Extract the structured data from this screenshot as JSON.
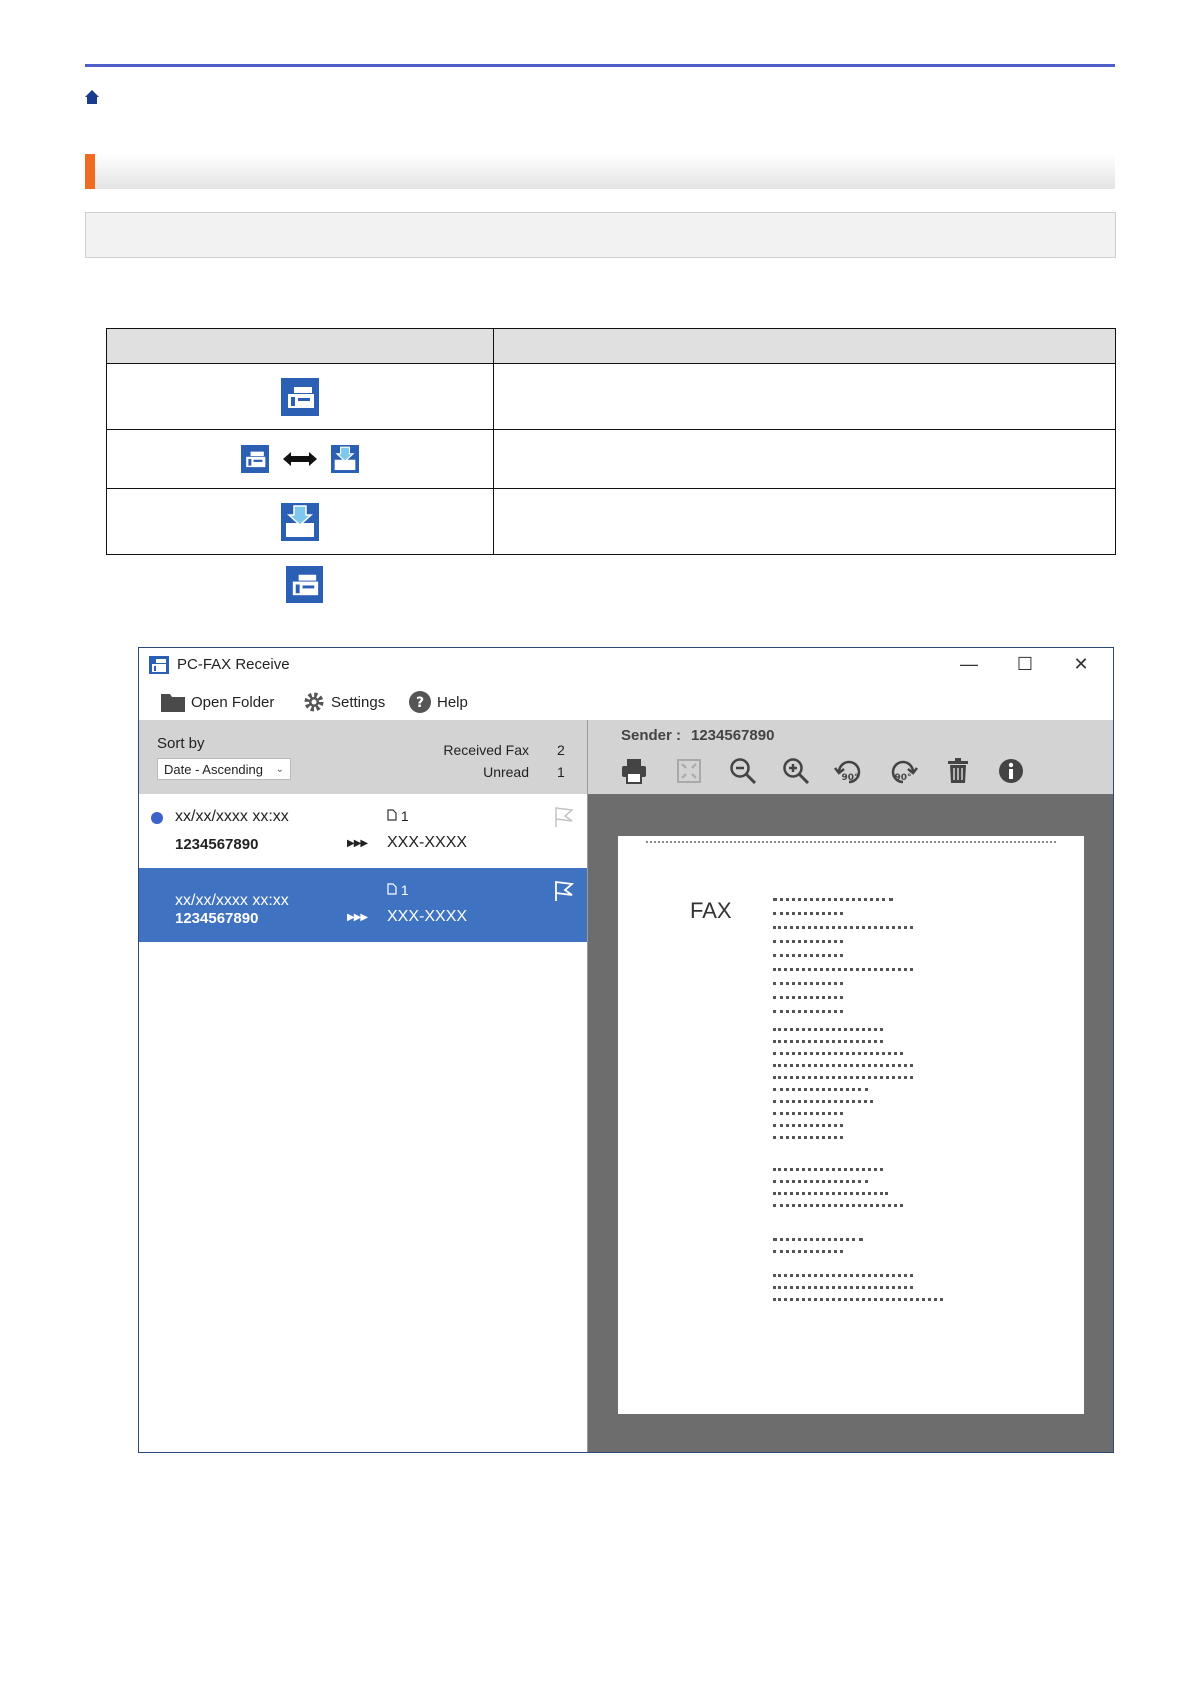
{
  "window": {
    "title": "PC-FAX Receive",
    "controls": {
      "minimize": "—",
      "maximize": "☐",
      "close": "✕"
    }
  },
  "toolbar": {
    "open_folder": "Open Folder",
    "settings": "Settings",
    "help": "Help"
  },
  "list_header": {
    "sort_label": "Sort by",
    "sort_value": "Date - Ascending",
    "received_label": "Received Fax",
    "received_count": "2",
    "unread_label": "Unread",
    "unread_count": "1"
  },
  "faxes": [
    {
      "datetime": "xx/xx/xxxx xx:xx",
      "pages": "1",
      "number": "1234567890",
      "sender": "XXX-XXXX",
      "unread": true,
      "selected": false
    },
    {
      "datetime": "xx/xx/xxxx xx:xx",
      "pages": "1",
      "number": "1234567890",
      "sender": "XXX-XXXX",
      "unread": false,
      "selected": true
    }
  ],
  "viewer": {
    "sender_label": "Sender :",
    "sender_value": "1234567890",
    "tools": [
      "print-icon",
      "fit-page-icon",
      "zoom-out-icon",
      "zoom-in-icon",
      "rotate-left-icon",
      "rotate-right-icon",
      "delete-icon",
      "info-icon"
    ],
    "rotate_left_text": "90°",
    "rotate_right_text": "90°",
    "document_heading": "FAX"
  },
  "colors": {
    "accent_line": "#4f5ec9",
    "heading_accent": "#f06b1f",
    "selection": "#3f72c0",
    "unread_dot": "#3b63c9"
  }
}
